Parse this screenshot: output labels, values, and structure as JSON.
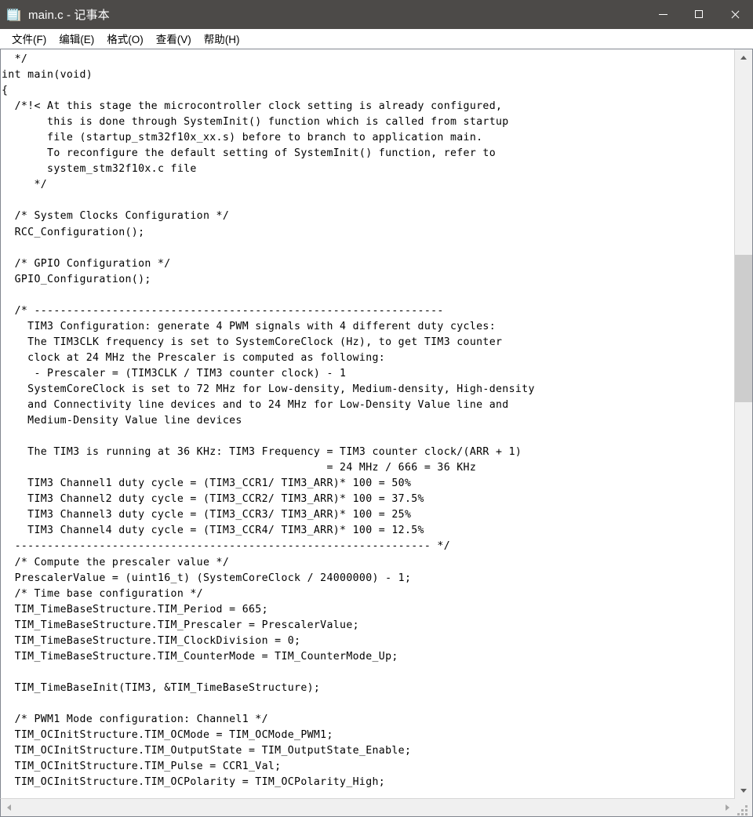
{
  "window": {
    "title": "main.c - 记事本",
    "icon": "notepad-icon"
  },
  "caption_buttons": [
    {
      "name": "minimize",
      "glyph": "minimize-icon",
      "tooltip": "最小化"
    },
    {
      "name": "maximize",
      "glyph": "maximize-icon",
      "tooltip": "最大化"
    },
    {
      "name": "close",
      "glyph": "close-icon",
      "tooltip": "关闭"
    }
  ],
  "menubar": {
    "items": [
      {
        "label": "文件(F)"
      },
      {
        "label": "编辑(E)"
      },
      {
        "label": "格式(O)"
      },
      {
        "label": "查看(V)"
      },
      {
        "label": "帮助(H)"
      }
    ]
  },
  "editor": {
    "text": "  */\nint main(void)\n{\n  /*!< At this stage the microcontroller clock setting is already configured,\n       this is done through SystemInit() function which is called from startup\n       file (startup_stm32f10x_xx.s) before to branch to application main.\n       To reconfigure the default setting of SystemInit() function, refer to\n       system_stm32f10x.c file\n     */\n\n  /* System Clocks Configuration */\n  RCC_Configuration();\n\n  /* GPIO Configuration */\n  GPIO_Configuration();\n\n  /* ---------------------------------------------------------------\n    TIM3 Configuration: generate 4 PWM signals with 4 different duty cycles:\n    The TIM3CLK frequency is set to SystemCoreClock (Hz), to get TIM3 counter\n    clock at 24 MHz the Prescaler is computed as following:\n     - Prescaler = (TIM3CLK / TIM3 counter clock) - 1\n    SystemCoreClock is set to 72 MHz for Low-density, Medium-density, High-density\n    and Connectivity line devices and to 24 MHz for Low-Density Value line and\n    Medium-Density Value line devices\n\n    The TIM3 is running at 36 KHz: TIM3 Frequency = TIM3 counter clock/(ARR + 1)\n                                                  = 24 MHz / 666 = 36 KHz\n    TIM3 Channel1 duty cycle = (TIM3_CCR1/ TIM3_ARR)* 100 = 50%\n    TIM3 Channel2 duty cycle = (TIM3_CCR2/ TIM3_ARR)* 100 = 37.5%\n    TIM3 Channel3 duty cycle = (TIM3_CCR3/ TIM3_ARR)* 100 = 25%\n    TIM3 Channel4 duty cycle = (TIM3_CCR4/ TIM3_ARR)* 100 = 12.5%\n  ---------------------------------------------------------------- */\n  /* Compute the prescaler value */\n  PrescalerValue = (uint16_t) (SystemCoreClock / 24000000) - 1;\n  /* Time base configuration */\n  TIM_TimeBaseStructure.TIM_Period = 665;\n  TIM_TimeBaseStructure.TIM_Prescaler = PrescalerValue;\n  TIM_TimeBaseStructure.TIM_ClockDivision = 0;\n  TIM_TimeBaseStructure.TIM_CounterMode = TIM_CounterMode_Up;\n\n  TIM_TimeBaseInit(TIM3, &TIM_TimeBaseStructure);\n\n  /* PWM1 Mode configuration: Channel1 */\n  TIM_OCInitStructure.TIM_OCMode = TIM_OCMode_PWM1;\n  TIM_OCInitStructure.TIM_OutputState = TIM_OutputState_Enable;\n  TIM_OCInitStructure.TIM_Pulse = CCR1_Val;\n  TIM_OCInitStructure.TIM_OCPolarity = TIM_OCPolarity_High;"
  },
  "scrollbars": {
    "vertical": {
      "thumb_top_pct": 26.5,
      "thumb_height_pct": 20.5,
      "up_arrow": "chevron-up-icon",
      "down_arrow": "chevron-down-icon"
    },
    "horizontal": {
      "left_arrow": "chevron-left-icon",
      "right_arrow": "chevron-right-icon"
    }
  },
  "colors": {
    "titlebar_bg": "#4c4a48",
    "titlebar_fg": "#ffffff",
    "editor_bg": "#ffffff",
    "editor_fg": "#000000",
    "scrollbar_track": "#f0f0f0",
    "scrollbar_thumb": "#cdcdcd",
    "border": "#828790"
  }
}
